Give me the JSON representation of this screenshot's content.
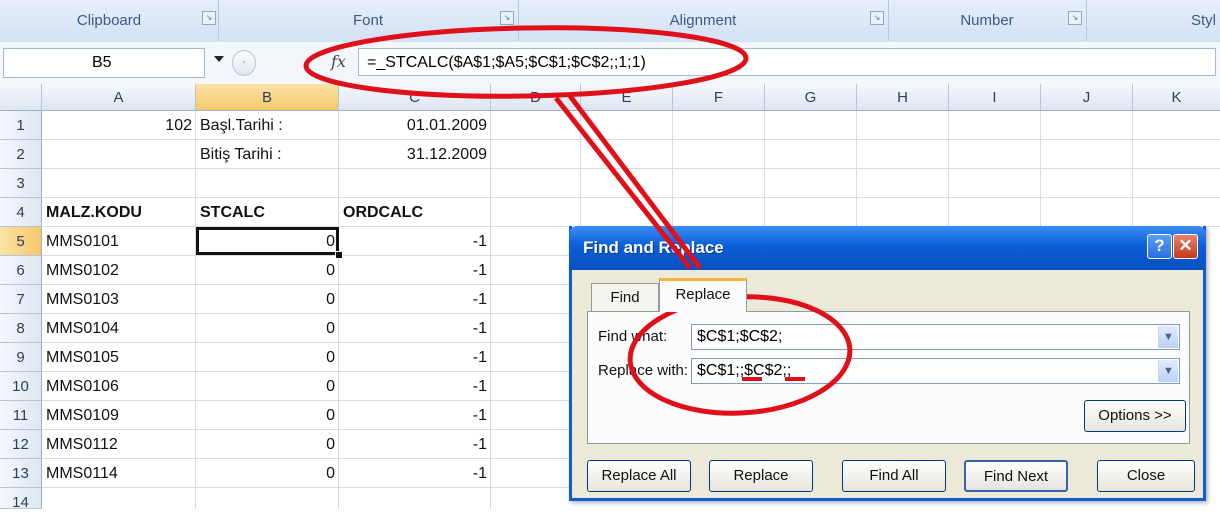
{
  "ribbon": {
    "groups": [
      "Clipboard",
      "Font",
      "Alignment",
      "Number",
      "Styl"
    ]
  },
  "formula_bar": {
    "name_box": "B5",
    "fx_label": "fx",
    "formula": "=_STCALC($A$1;$A5;$C$1;$C$2;;1;1)"
  },
  "sheet": {
    "columns": [
      "A",
      "B",
      "C",
      "D",
      "E",
      "F",
      "G",
      "H",
      "I",
      "J",
      "K"
    ],
    "selected_column": "B",
    "rows": [
      "1",
      "2",
      "3",
      "4",
      "5",
      "6",
      "7",
      "8",
      "9",
      "10",
      "11",
      "12",
      "13",
      "14"
    ],
    "selected_row": "5",
    "header_row": {
      "a": "MALZ.KODU",
      "b": "STCALC",
      "c": "ORDCALC"
    },
    "top": {
      "a1": "102",
      "b1": "Başl.Tarihi :",
      "c1": "01.01.2009",
      "b2": "Bitiş Tarihi :",
      "c2": "31.12.2009"
    },
    "data": [
      {
        "a": "MMS0101",
        "b": "0",
        "c": "-1"
      },
      {
        "a": "MMS0102",
        "b": "0",
        "c": "-1"
      },
      {
        "a": "MMS0103",
        "b": "0",
        "c": "-1"
      },
      {
        "a": "MMS0104",
        "b": "0",
        "c": "-1"
      },
      {
        "a": "MMS0105",
        "b": "0",
        "c": "-1"
      },
      {
        "a": "MMS0106",
        "b": "0",
        "c": "-1"
      },
      {
        "a": "MMS0109",
        "b": "0",
        "c": "-1"
      },
      {
        "a": "MMS0112",
        "b": "0",
        "c": "-1"
      },
      {
        "a": "MMS0114",
        "b": "0",
        "c": "-1"
      }
    ]
  },
  "dialog": {
    "title": "Find and Replace",
    "help_glyph": "?",
    "close_glyph": "✕",
    "tabs": [
      "Find",
      "Replace"
    ],
    "active_tab": "Replace",
    "find_label": "Find what:",
    "find_value": "$C$1;$C$2;",
    "replace_label": "Replace with:",
    "replace_value": "$C$1;;$C$2;;",
    "options_button": "Options >>",
    "buttons": [
      "Replace All",
      "Replace",
      "Find All",
      "Find Next",
      "Close"
    ]
  },
  "colors": {
    "annotation": "#e0101a",
    "dialog_title": "#0a5fd8",
    "selected_header": "#f5c86b"
  }
}
